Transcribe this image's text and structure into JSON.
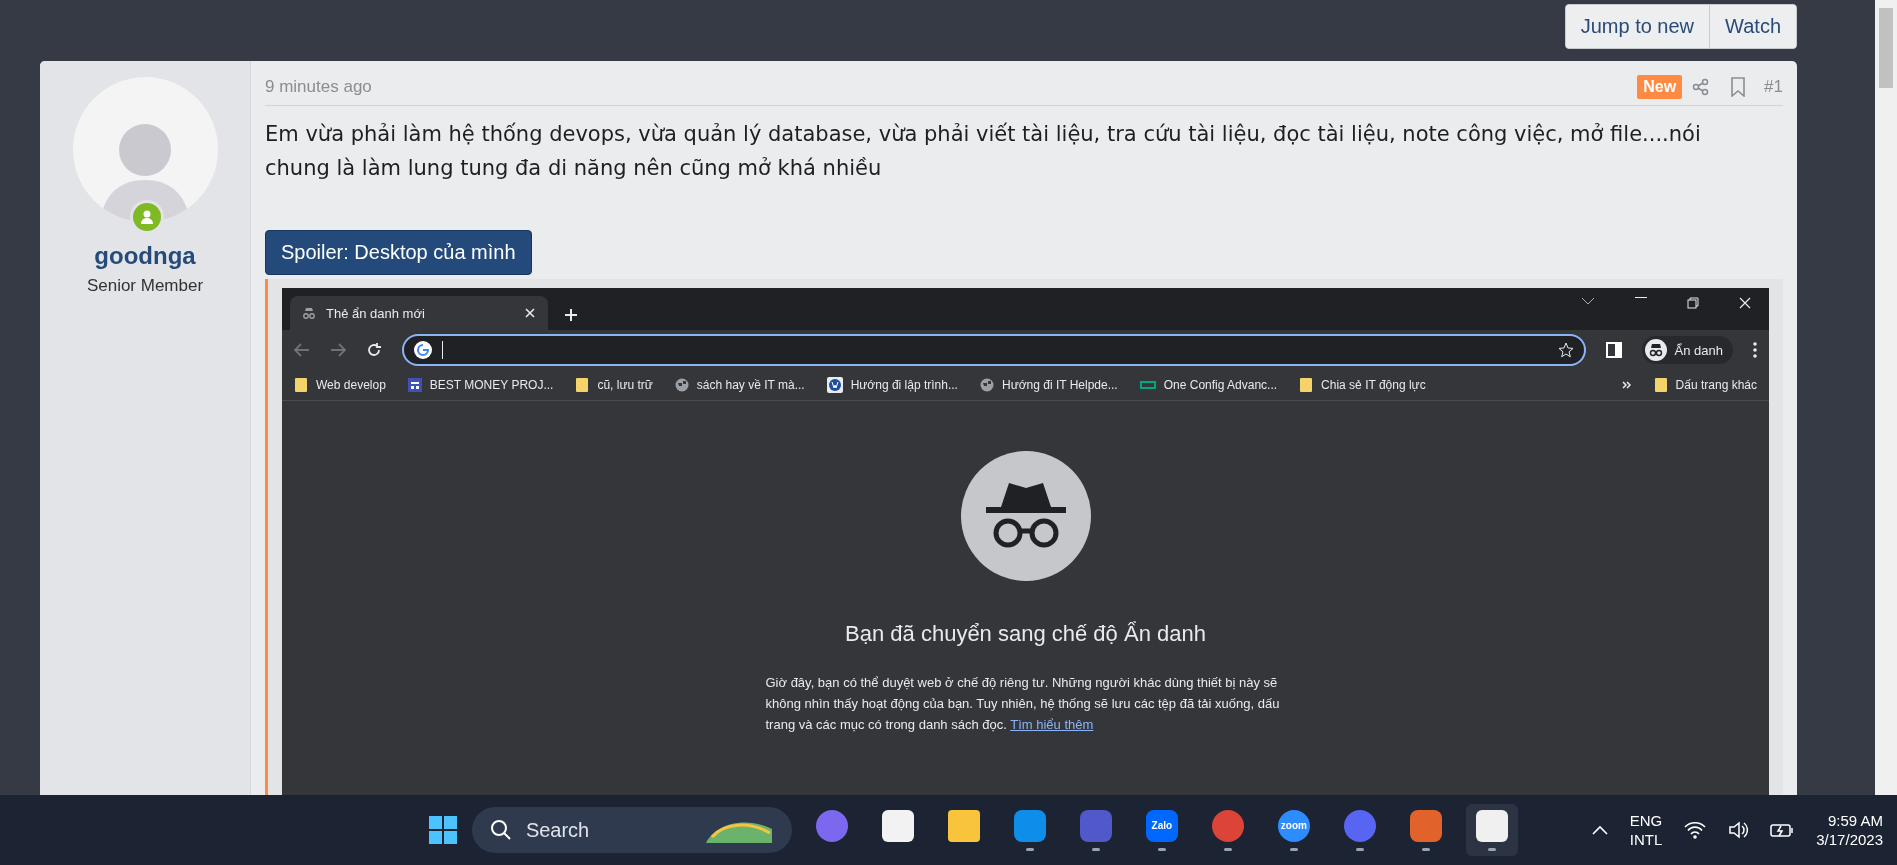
{
  "thread_actions": [
    {
      "label": "Jump to new"
    },
    {
      "label": "Watch"
    }
  ],
  "post": {
    "author": {
      "name": "goodnga",
      "title": "Senior Member",
      "online": true
    },
    "time": "9 minutes ago",
    "new_badge": "New",
    "number": "#1",
    "body": "Em vừa phải làm hệ thống devops, vừa quản lý database, vừa phải viết tài liệu, tra cứu tài liệu, đọc tài liệu, note công việc, mở file....nói chung là làm lung tung đa di năng nên cũng mở khá nhiều",
    "spoiler": {
      "label": "Spoiler: Desktop của mình",
      "expanded": true
    }
  },
  "browser": {
    "tab": {
      "title": "Thẻ ẩn danh mới"
    },
    "profile": "Ẩn danh",
    "bookmarks": [
      {
        "kind": "folder",
        "label": "Web develop"
      },
      {
        "kind": "board",
        "label": "BEST MONEY PROJ..."
      },
      {
        "kind": "folder",
        "label": "cũ, lưu trữ"
      },
      {
        "kind": "globe",
        "label": "sách hay về IT mà..."
      },
      {
        "kind": "blog",
        "label": "Hướng đi lập trình..."
      },
      {
        "kind": "globe",
        "label": "Hướng đi IT Helpde..."
      },
      {
        "kind": "bar",
        "label": "One Config Advanc..."
      },
      {
        "kind": "folder",
        "label": "Chia sẻ IT động lực"
      }
    ],
    "other_bookmarks": "Dấu trang khác",
    "heading": "Bạn đã chuyển sang chế độ Ẩn danh",
    "paragraph": "Giờ đây, bạn có thể duyệt web ở chế độ riêng tư. Những người khác dùng thiết bị này sẽ không nhìn thấy hoạt động của bạn. Tuy nhiên, hệ thống sẽ lưu các tệp đã tải xuống, dấu trang và các mục có trong danh sách đọc.",
    "link": "Tìm hiểu thêm"
  },
  "taskbar": {
    "search": "Search",
    "apps": [
      {
        "kind": "video",
        "running": false
      },
      {
        "kind": "store",
        "running": false
      },
      {
        "kind": "files",
        "running": false
      },
      {
        "kind": "remote",
        "running": true
      },
      {
        "kind": "teams",
        "running": true
      },
      {
        "kind": "chat",
        "label": "Zalo",
        "running": true
      },
      {
        "kind": "chrome",
        "running": true
      },
      {
        "kind": "meet",
        "label": "zoom",
        "running": true
      },
      {
        "kind": "discord",
        "running": true
      },
      {
        "kind": "tool",
        "running": true
      },
      {
        "kind": "snip",
        "running": true
      }
    ],
    "language": [
      "ENG",
      "INTL"
    ],
    "time": "9:59 AM",
    "date": "3/17/2023"
  }
}
